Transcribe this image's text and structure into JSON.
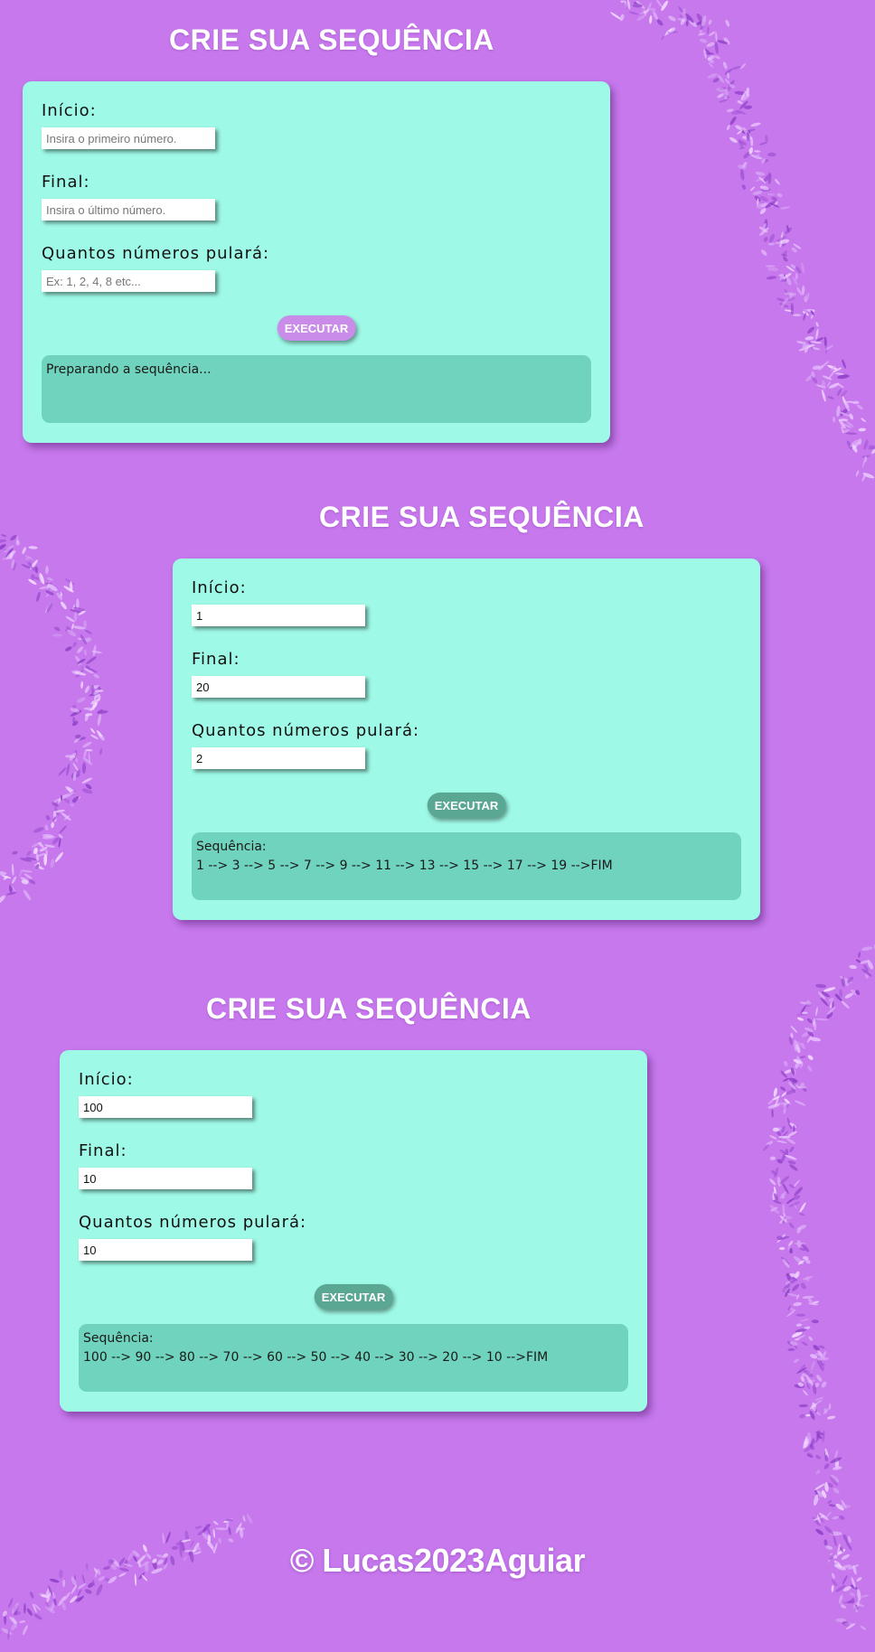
{
  "colors": {
    "background": "#c678ec",
    "card": "#9ef9e6",
    "result_box": "#6fd3bd",
    "button_idle": "#c98ce9",
    "button_active": "#5aa794"
  },
  "panels": [
    {
      "title": "CRIE SUA SEQUÊNCIA",
      "inicio_label": "Início:",
      "inicio_value": "",
      "inicio_placeholder": "Insira o primeiro número.",
      "final_label": "Final:",
      "final_value": "",
      "final_placeholder": "Insira o último número.",
      "passo_label": "Quantos números pulará:",
      "passo_value": "",
      "passo_placeholder": "Ex: 1, 2, 4, 8 etc...",
      "button_label": "EXECUTAR",
      "result_line1": "Preparando a sequência...",
      "result_line2": ""
    },
    {
      "title": "CRIE SUA SEQUÊNCIA",
      "inicio_label": "Início:",
      "inicio_value": "1",
      "inicio_placeholder": "Insira o primeiro número.",
      "final_label": "Final:",
      "final_value": "20",
      "final_placeholder": "Insira o último número.",
      "passo_label": "Quantos números pulará:",
      "passo_value": "2",
      "passo_placeholder": "Ex: 1, 2, 4, 8 etc...",
      "button_label": "EXECUTAR",
      "result_line1": "Sequência:",
      "result_line2": "1 --> 3 --> 5 --> 7 --> 9 --> 11 --> 13 --> 15 --> 17 --> 19 -->FIM"
    },
    {
      "title": "CRIE SUA SEQUÊNCIA",
      "inicio_label": "Início:",
      "inicio_value": "100",
      "inicio_placeholder": "Insira o primeiro número.",
      "final_label": "Final:",
      "final_value": "10",
      "final_placeholder": "Insira o último número.",
      "passo_label": "Quantos números pulará:",
      "passo_value": "10",
      "passo_placeholder": "Ex: 1, 2, 4, 8 etc...",
      "button_label": "EXECUTAR",
      "result_line1": "Sequência:",
      "result_line2": "100 --> 90 --> 80 --> 70 --> 60 --> 50 --> 40 --> 30 --> 20 --> 10 -->FIM"
    }
  ],
  "footer": "© Lucas2023Aguiar"
}
